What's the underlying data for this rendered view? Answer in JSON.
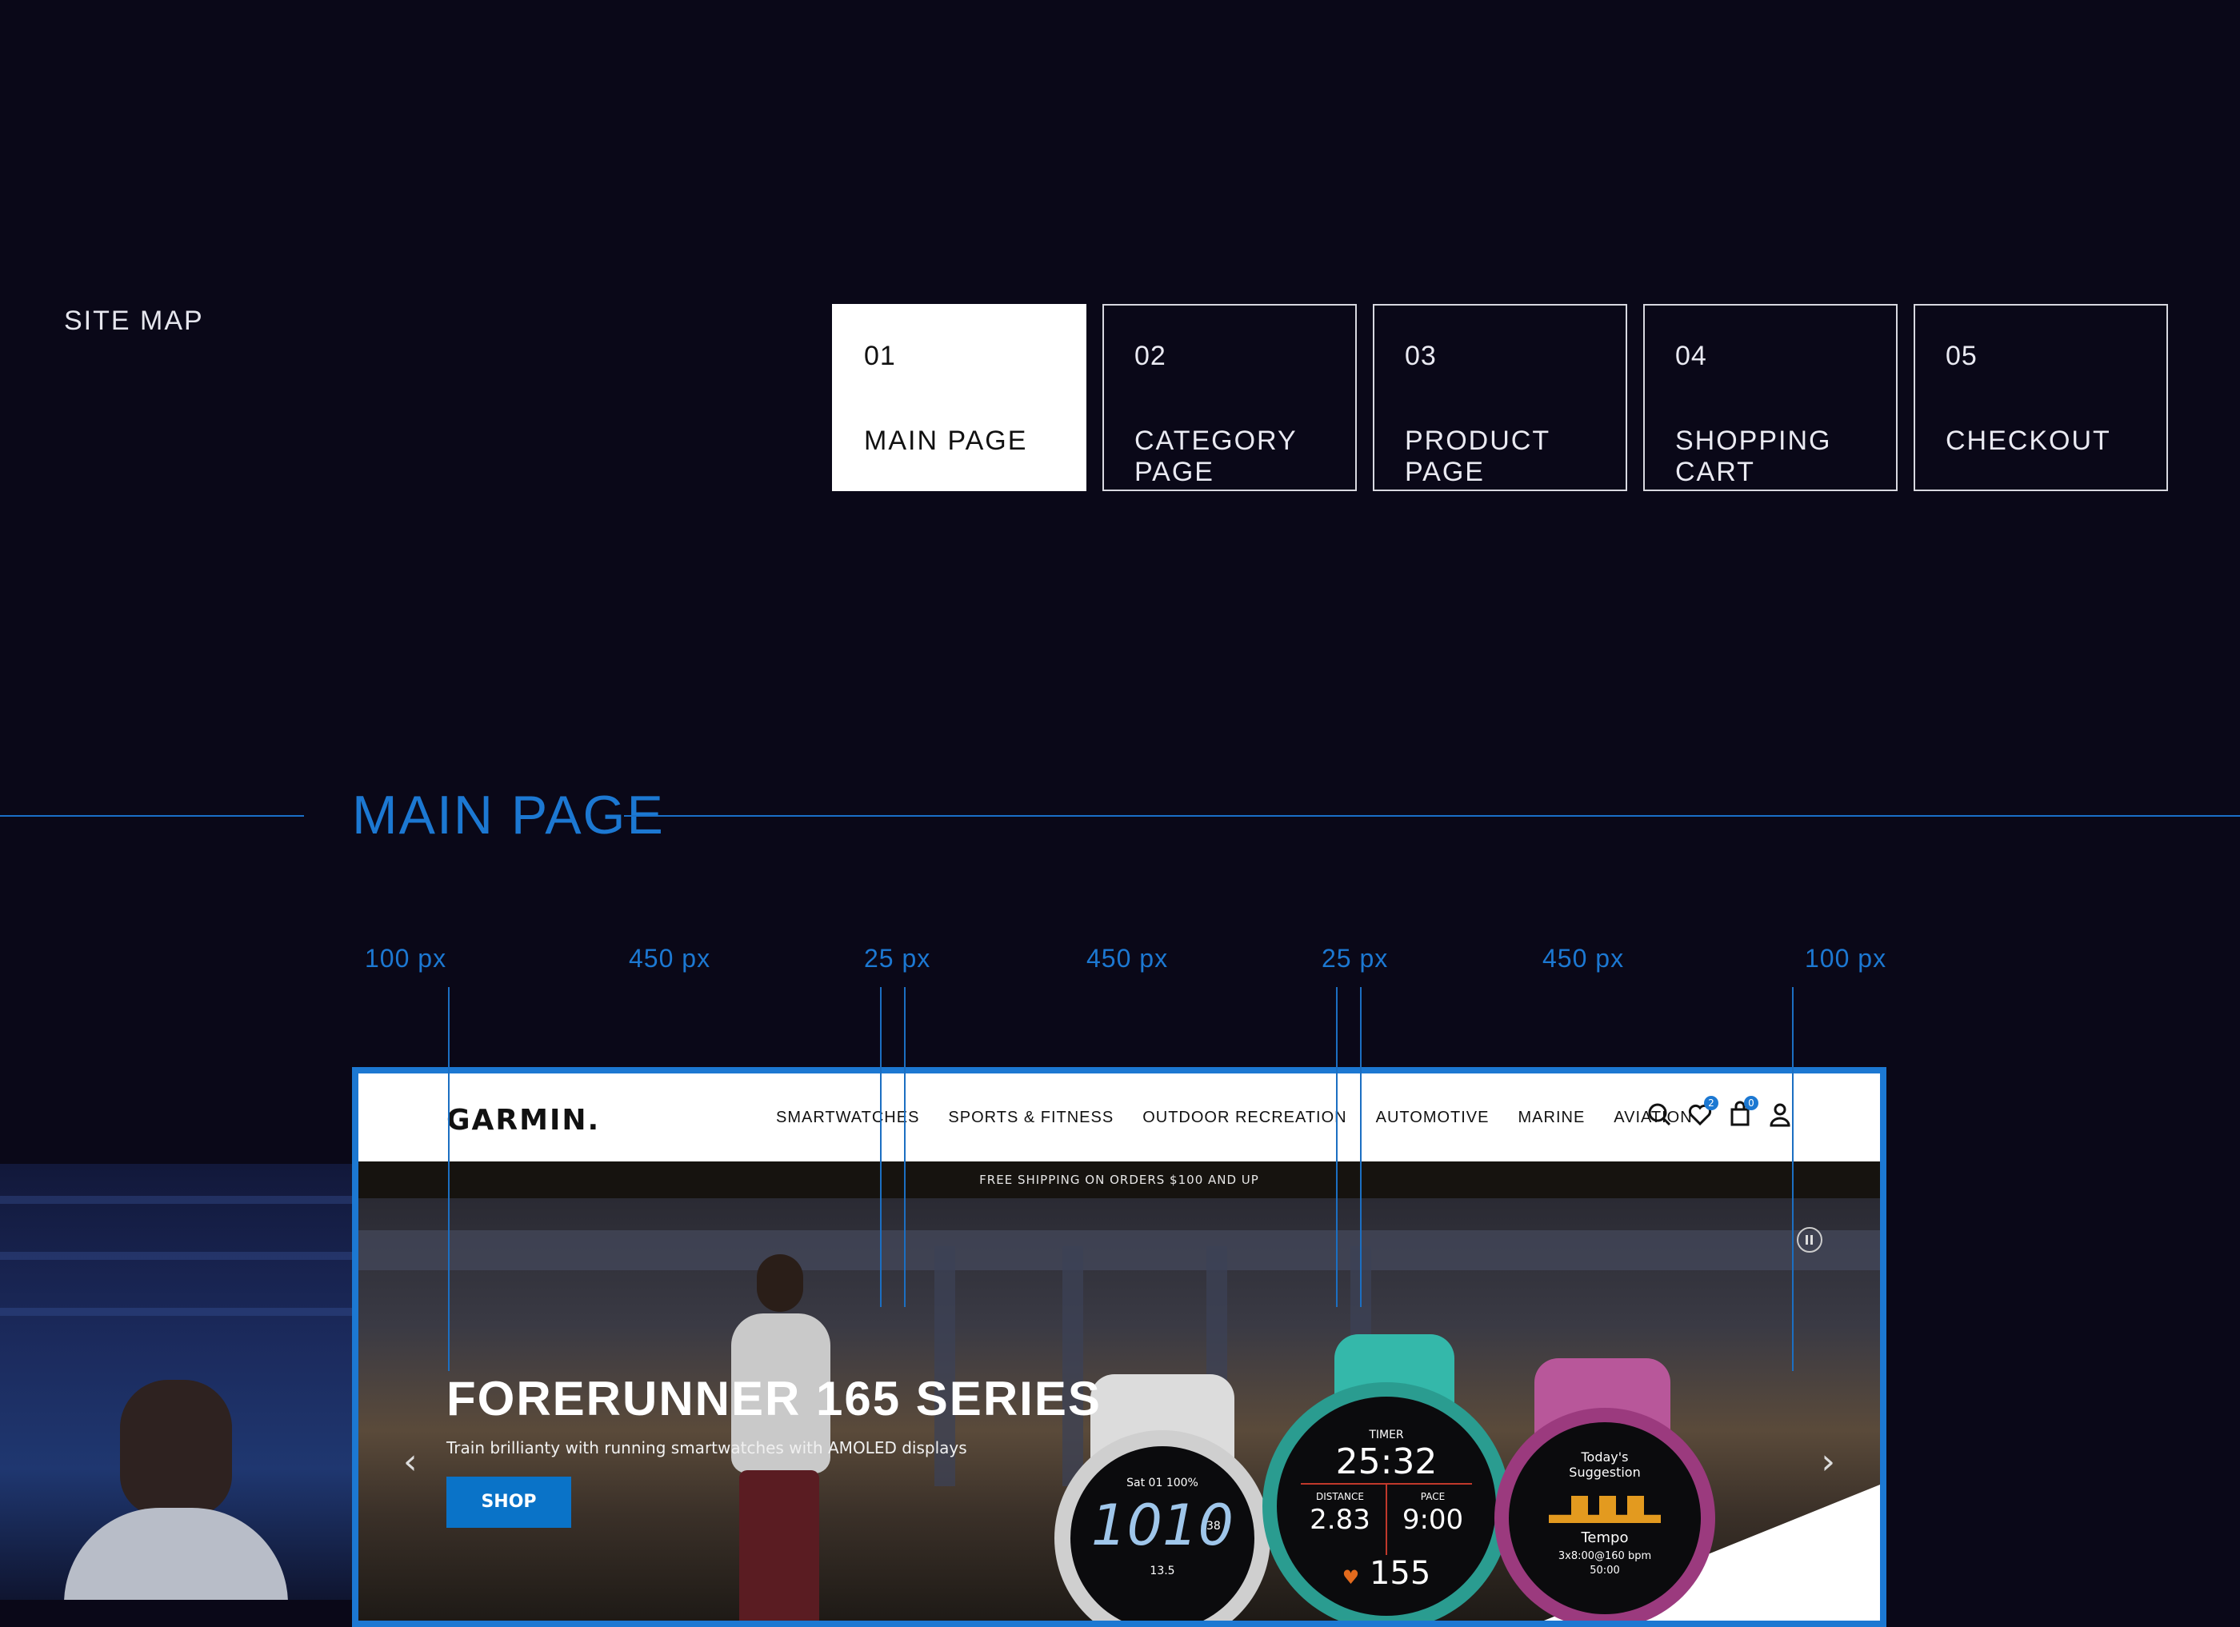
{
  "sitemap": {
    "label": "SITE MAP",
    "tabs": [
      {
        "num": "01",
        "label": "MAIN PAGE",
        "active": true
      },
      {
        "num": "02",
        "label": "CATEGORY PAGE",
        "active": false
      },
      {
        "num": "03",
        "label": "PRODUCT PAGE",
        "active": false
      },
      {
        "num": "04",
        "label": "SHOPPING CART",
        "active": false
      },
      {
        "num": "05",
        "label": "CHECKOUT",
        "active": false
      }
    ]
  },
  "section": {
    "title": "MAIN PAGE"
  },
  "grid": {
    "labels": [
      "100 px",
      "450 px",
      "25 px",
      "450 px",
      "25 px",
      "450 px",
      "100 px"
    ]
  },
  "mockup": {
    "logo": "GARMIN.",
    "menu": [
      "SMARTWATCHES",
      "SPORTS & FITNESS",
      "OUTDOOR RECREATION",
      "AUTOMOTIVE",
      "MARINE",
      "AVIATION"
    ],
    "wishlist_count": "2",
    "cart_count": "0",
    "shipping_banner": "FREE SHIPPING ON ORDERS $100 AND UP",
    "hero": {
      "title": "FORERUNNER 165 SERIES",
      "subtitle": "Train brillianty with running smartwatches with AMOLED displays",
      "cta": "SHOP"
    },
    "watches": {
      "left": {
        "date": "Sat 01",
        "battery": "100%",
        "time": "1010",
        "seconds": "38",
        "distance": "13.5"
      },
      "center": {
        "label": "TIMER",
        "time": "25:32",
        "dist_label": "DISTANCE",
        "dist": "2.83",
        "pace_label": "PACE",
        "pace": "9:00",
        "hr": "155"
      },
      "right": {
        "heading": "Today's Suggestion",
        "workout": "Tempo",
        "detail": "3x8:00@160 bpm",
        "duration": "50:00"
      }
    }
  },
  "colors": {
    "background": "#0a0818",
    "accent": "#1c78d2",
    "cta": "#0a73c8"
  }
}
